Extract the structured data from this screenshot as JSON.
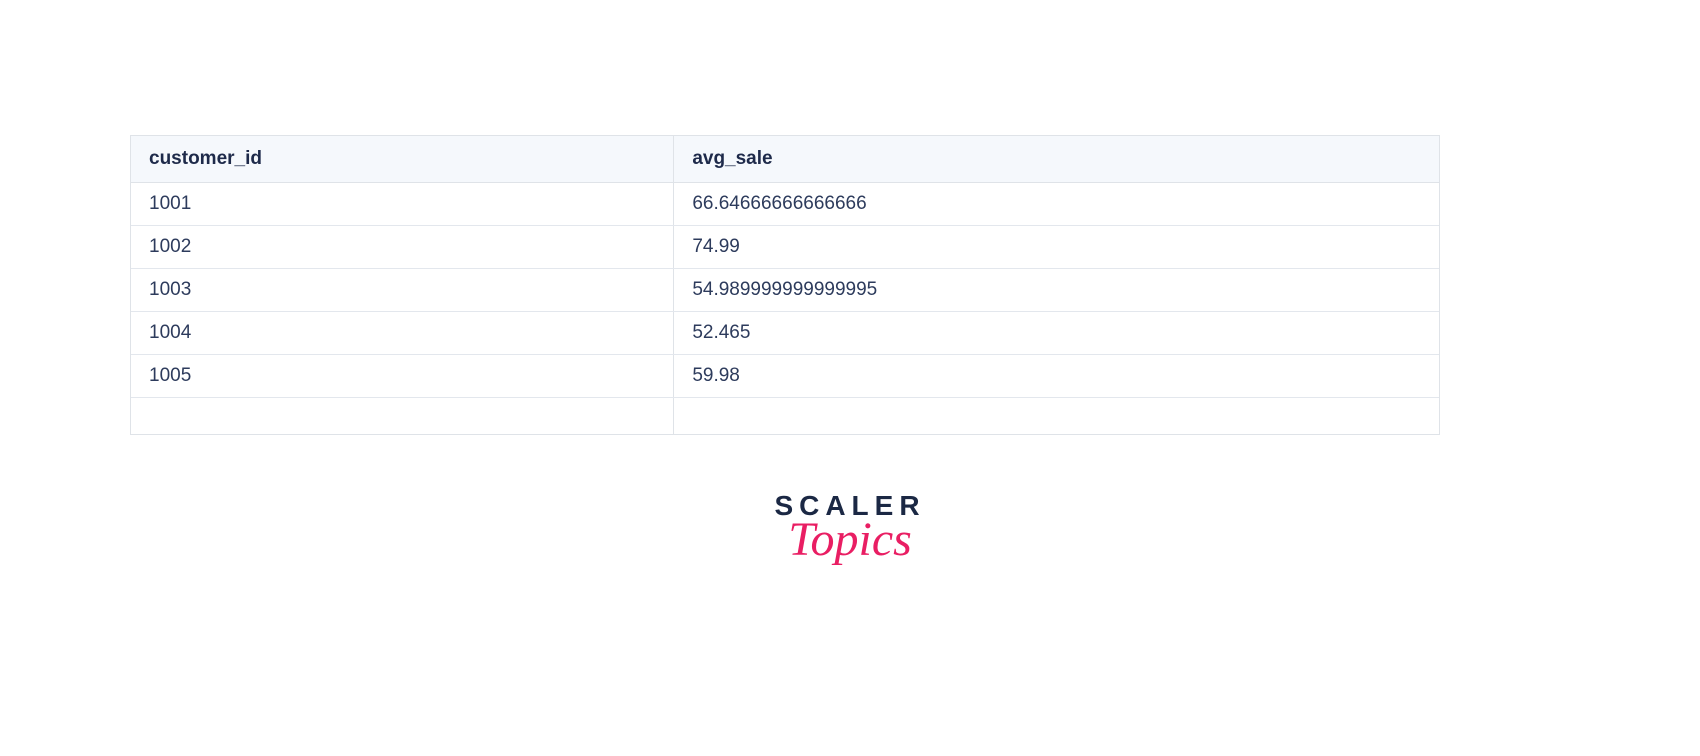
{
  "table": {
    "headers": [
      "customer_id",
      "avg_sale"
    ],
    "rows": [
      [
        "1001",
        "66.64666666666666"
      ],
      [
        "1002",
        "74.99"
      ],
      [
        "1003",
        "54.989999999999995"
      ],
      [
        "1004",
        "52.465"
      ],
      [
        "1005",
        "59.98"
      ]
    ]
  },
  "logo": {
    "line1": "SCALER",
    "line2": "Topics"
  }
}
